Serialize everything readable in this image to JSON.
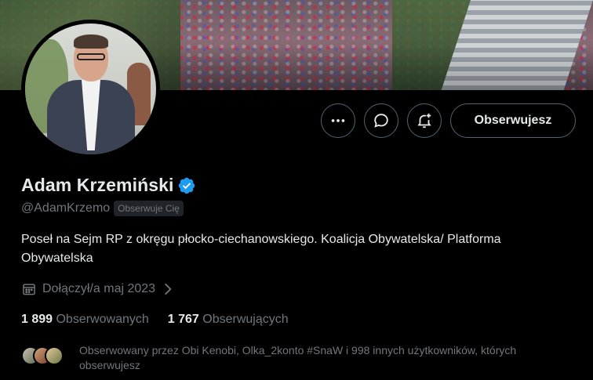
{
  "profile": {
    "name": "Adam Krzemiński",
    "handle": "@AdamKrzemo",
    "follows_you_badge": "Obserwuje Cię",
    "bio": "Poseł na Sejm RP z okręgu płocko-ciechanowskiego.  Koalicja Obywatelska/ Platforma Obywatelska",
    "joined": "Dołączył/a maj 2023",
    "verified": true
  },
  "actions": {
    "more_icon": "more-horizontal-icon",
    "message_icon": "message-icon",
    "notify_icon": "bell-plus-icon",
    "follow_label": "Obserwujesz"
  },
  "stats": {
    "following_count": "1 899",
    "following_label": "Obserwowanych",
    "followers_count": "1 767",
    "followers_label": "Obserwujących"
  },
  "followed_by": {
    "text": "Obserwowany przez Obi Kenobi, Olka_2konto #SnaW i 998 innych użytkowników, których obserwujesz"
  },
  "colors": {
    "background": "#000000",
    "text_primary": "#e7e9ea",
    "text_secondary": "#71767b",
    "border": "#536471",
    "verified": "#1d9bf0"
  }
}
